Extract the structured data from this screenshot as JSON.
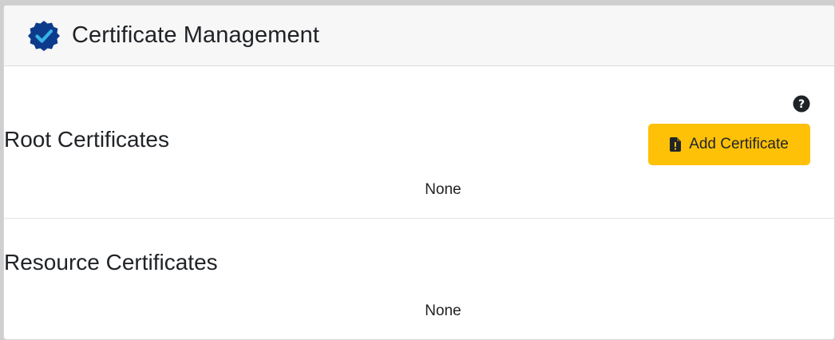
{
  "header": {
    "title": "Certificate Management",
    "icon": "verified-badge-icon",
    "icon_color": "#0d3b8c",
    "check_color": "#36b4e5"
  },
  "help": {
    "icon": "question-circle-icon",
    "symbol": "?"
  },
  "root_section": {
    "title": "Root Certificates",
    "empty_text": "None",
    "add_button": {
      "label": "Add Certificate",
      "icon": "file-exclamation-icon",
      "color": "#ffc107"
    }
  },
  "resource_section": {
    "title": "Resource Certificates",
    "empty_text": "None"
  }
}
